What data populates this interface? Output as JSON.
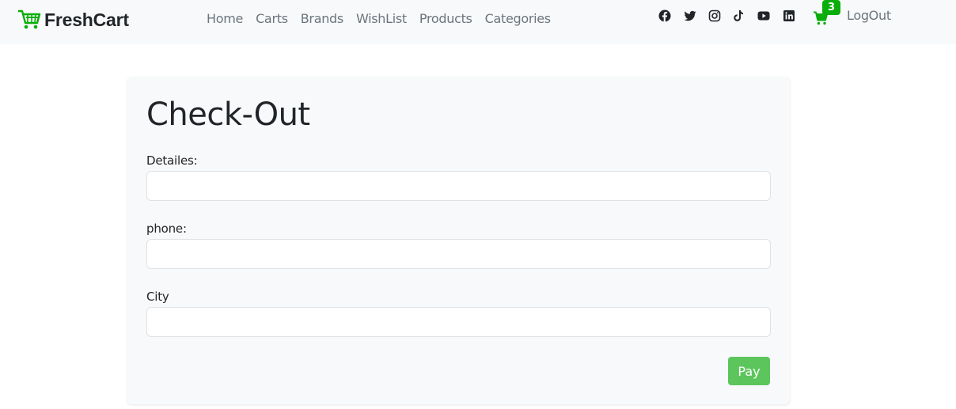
{
  "brand": {
    "name": "FreshCart",
    "accent": "#0aad0a"
  },
  "nav": {
    "links": [
      "Home",
      "Carts",
      "Brands",
      "WishList",
      "Products",
      "Categories"
    ],
    "social_icons": [
      "facebook-icon",
      "twitter-icon",
      "instagram-icon",
      "tiktok-icon",
      "youtube-icon",
      "linkedin-icon"
    ],
    "cart_count": "3",
    "logout_label": "LogOut"
  },
  "checkout": {
    "title": "Check-Out",
    "fields": [
      {
        "label": "Detailes:",
        "value": ""
      },
      {
        "label": "phone:",
        "value": ""
      },
      {
        "label": "City",
        "value": ""
      }
    ],
    "pay_label": "Pay",
    "pay_color": "#5cc55c"
  }
}
